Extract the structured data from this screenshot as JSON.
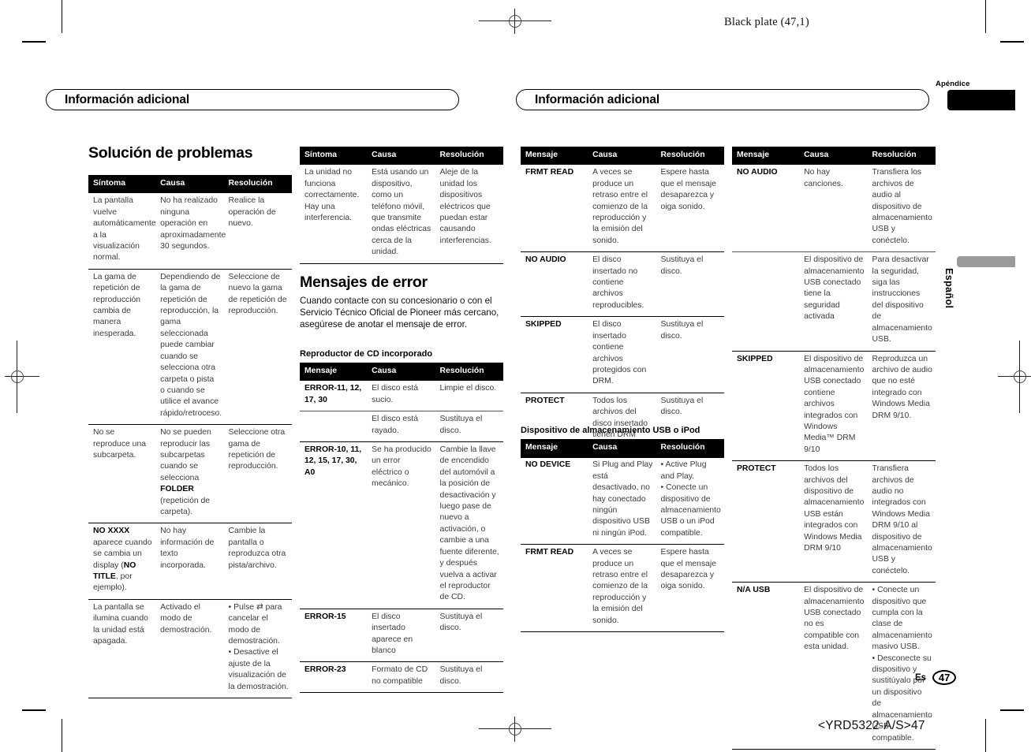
{
  "print_marks": {
    "plate_label": "Black plate (47,1)",
    "footer_code": "<YRD5322-A/S>47"
  },
  "left_page": {
    "running_head": "Información adicional",
    "column1": {
      "section_title": "Solución de problemas",
      "table": {
        "headers": [
          "Síntoma",
          "Causa",
          "Resolución"
        ],
        "rows": [
          {
            "group": true,
            "symptom": "La pantalla vuelve automáticamente a la visualización normal.",
            "cause": "No ha realizado ninguna operación en aproximadamente 30 segundos.",
            "resolution": "Realice la operación de nuevo."
          },
          {
            "group": true,
            "symptom": "La gama de repetición de reproducción cambia de manera inesperada.",
            "cause": "Dependiendo de la gama de repetición de reproducción, la gama seleccionada puede cambiar cuando se selecciona otra carpeta o pista o cuando se utilice el avance rápido/retroceso.",
            "resolution": "Seleccione de nuevo la gama de repetición de reproducción."
          },
          {
            "group": true,
            "symptom": "No se reproduce una subcarpeta.",
            "cause_parts": [
              "No se pueden reproducir las subcarpetas cuando se selecciona ",
              "FOLDER",
              " (repetición de carpeta)."
            ],
            "resolution": "Seleccione otra gama de repetición de reproducción."
          },
          {
            "group": true,
            "symptom_parts": [
              "NO XXXX",
              " aparece cuando se cambia un display (",
              "NO TITLE",
              ", por ejemplo)."
            ],
            "cause": "No hay información de texto incorporada.",
            "resolution": "Cambie la pantalla o reproduzca otra pista/archivo."
          },
          {
            "group": true,
            "last": true,
            "symptom": "La pantalla se ilumina cuando la unidad está apagada.",
            "cause": "Activado el modo de demostración.",
            "resolution_bullets": [
              "Pulse ⇄ para cancelar el modo de demostración.",
              "Desactive el ajuste de la visualización de la demostración."
            ]
          }
        ]
      }
    },
    "column2": {
      "table": {
        "headers": [
          "Síntoma",
          "Causa",
          "Resolución"
        ],
        "rows": [
          {
            "group": true,
            "last": true,
            "symptom": "La unidad no funciona correctamente. Hay una interferencia.",
            "cause": "Está usando un dispositivo, como un teléfono móvil, que transmite ondas eléctricas cerca de la unidad.",
            "resolution": "Aleje de la unidad los dispositivos eléctricos que puedan estar causando interferencias."
          }
        ]
      },
      "error_section_title": "Mensajes de error",
      "error_intro": "Cuando contacte con su concesionario o con el Servicio Técnico Oficial de Pioneer más cercano, asegúrese de anotar el mensaje de error.",
      "cd_subtitle": "Reproductor de CD incorporado",
      "cd_table": {
        "headers": [
          "Mensaje",
          "Causa",
          "Resolución"
        ],
        "rows": [
          {
            "group": true,
            "message": "ERROR-11, 12, 17, 30",
            "cause": "El disco está sucio.",
            "resolution": "Limpie el disco."
          },
          {
            "sub": true,
            "message": "",
            "cause": "El disco está rayado.",
            "resolution": "Sustituya el disco."
          },
          {
            "group": true,
            "message": "ERROR-10, 11, 12, 15, 17, 30, A0",
            "cause": "Se ha producido un error eléctrico o mecánico.",
            "resolution": "Cambie la llave de encendido del automóvil a la posición de desactivación y luego pase de nuevo a activación, o cambie a una fuente diferente, y después vuelva a activar el reproductor de CD."
          },
          {
            "group": true,
            "message": "ERROR-15",
            "cause": "El disco insertado aparece en blanco",
            "resolution": "Sustituya el disco."
          },
          {
            "group": true,
            "last": true,
            "message": "ERROR-23",
            "cause": "Formato de CD no compatible",
            "resolution": "Sustituya el disco."
          }
        ]
      }
    }
  },
  "right_page": {
    "running_head": "Información adicional",
    "appendix_tab_label": "Apéndice",
    "language_tab_label": "Español",
    "page_footer": {
      "lang_code": "Es",
      "page_number": "47"
    },
    "column1": {
      "table": {
        "headers": [
          "Mensaje",
          "Causa",
          "Resolución"
        ],
        "rows": [
          {
            "group": true,
            "message": "FRMT READ",
            "cause": "A veces se produce un retraso entre el comienzo de la reproducción y la emisión del sonido.",
            "resolution": "Espere hasta que el mensaje desaparezca y oiga sonido."
          },
          {
            "group": true,
            "message": "NO AUDIO",
            "cause": "El disco insertado no contiene archivos reproducibles.",
            "resolution": "Sustituya el disco."
          },
          {
            "group": true,
            "message": "SKIPPED",
            "cause": "El disco insertado contiene archivos protegidos con DRM.",
            "resolution": "Sustituya el disco."
          },
          {
            "group": true,
            "last": true,
            "message": "PROTECT",
            "cause": "Todos los archivos del disco insertado tienen DRM integrado.",
            "resolution": "Sustituya el disco."
          }
        ]
      },
      "usb_subtitle": "Dispositivo de almacenamiento USB o iPod",
      "usb_table": {
        "headers": [
          "Mensaje",
          "Causa",
          "Resolución"
        ],
        "rows": [
          {
            "group": true,
            "message": "NO DEVICE",
            "cause": "Si Plug and Play está desactivado, no hay conectado ningún dispositivo USB ni ningún iPod.",
            "resolution_bullets": [
              "Active Plug and Play.",
              "Conecte un dispositivo de almacenamiento USB o un iPod compatible."
            ]
          },
          {
            "group": true,
            "last": true,
            "message": "FRMT READ",
            "cause": "A veces se produce un retraso entre el comienzo de la reproducción y la emisión del sonido.",
            "resolution": "Espere hasta que el mensaje desaparezca y oiga sonido."
          }
        ]
      }
    },
    "column2": {
      "table": {
        "headers": [
          "Mensaje",
          "Causa",
          "Resolución"
        ],
        "rows": [
          {
            "group": true,
            "message": "NO AUDIO",
            "cause": "No hay canciones.",
            "resolution": "Transfiera los archivos de audio al dispositivo de almacenamiento USB y conéctelo."
          },
          {
            "sub": true,
            "message": "",
            "cause": "El dispositivo de almacenamiento USB conectado tiene la seguridad activada",
            "resolution": "Para desactivar la seguridad, siga las instrucciones del dispositivo de almacenamiento USB."
          },
          {
            "group": true,
            "message": "SKIPPED",
            "cause": "El dispositivo de almacenamiento USB conectado contiene archivos integrados con Windows Media™ DRM 9/10",
            "resolution": "Reproduzca un archivo de audio que no esté integrado con Windows Media DRM 9/10."
          },
          {
            "group": true,
            "message": "PROTECT",
            "cause": "Todos los archivos del dispositivo de almacenamiento USB están integrados con Windows Media DRM 9/10",
            "resolution": "Transfiera archivos de audio no integrados con Windows Media DRM 9/10 al dispositivo de almacenamiento USB y conéctelo."
          },
          {
            "group": true,
            "last": true,
            "message": "N/A USB",
            "cause": "El dispositivo de almacenamiento USB conectado no es compatible con esta unidad.",
            "resolution_bullets": [
              "Conecte un dispositivo que cumpla con la clase de almacenamiento masivo USB.",
              "Desconecte su dispositivo y sustitúyalo por un dispositivo de almacenamiento USB compatible."
            ]
          }
        ]
      }
    }
  }
}
